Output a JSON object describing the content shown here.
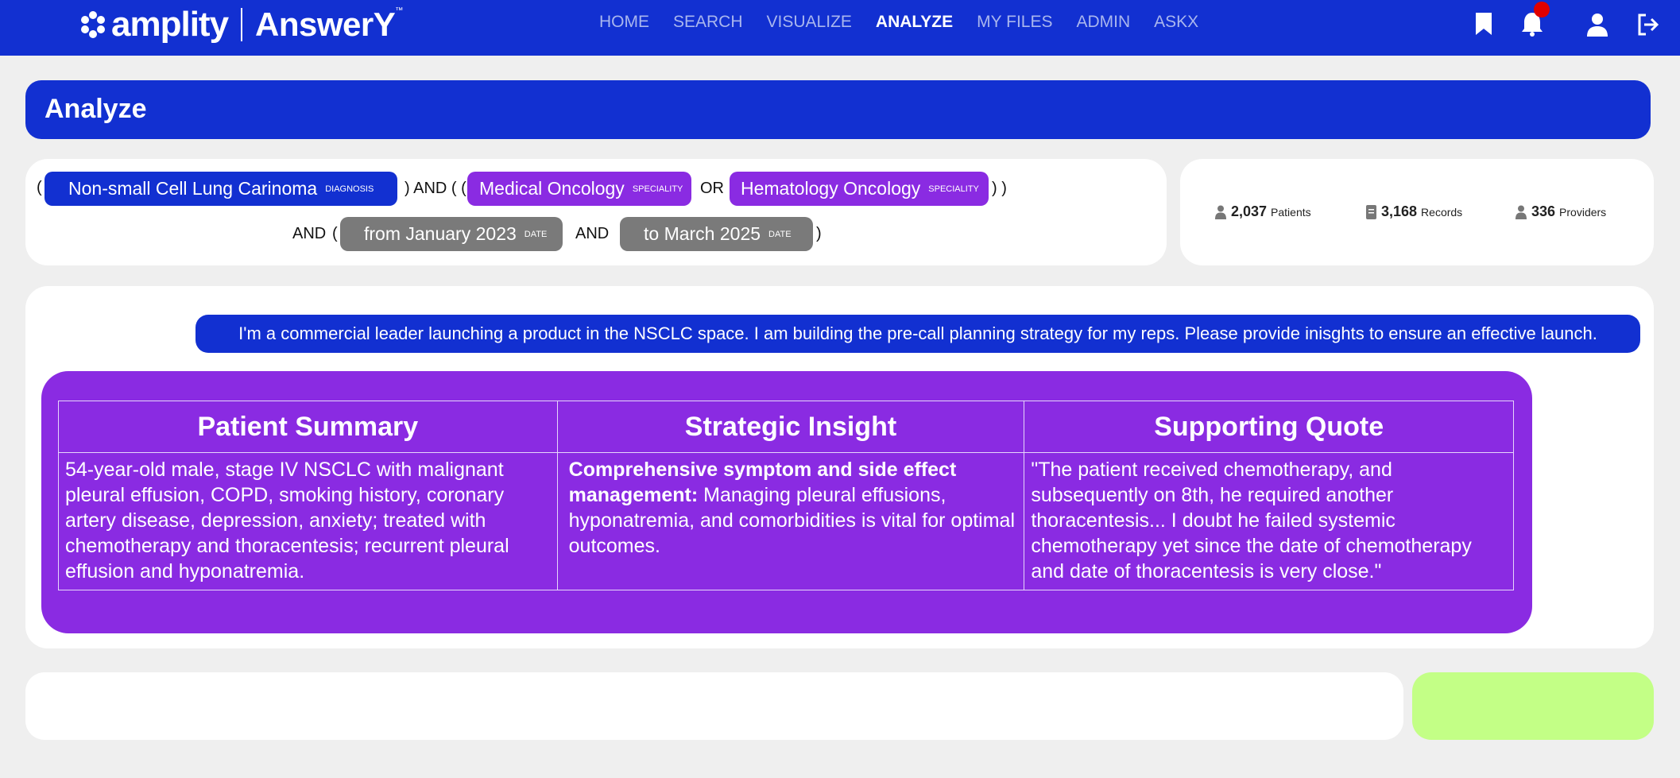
{
  "header": {
    "brand": "amplity",
    "product": "AnswerY",
    "trademark": "™",
    "nav": [
      {
        "label": "HOME",
        "active": false
      },
      {
        "label": "SEARCH",
        "active": false
      },
      {
        "label": "VISUALIZE",
        "active": false
      },
      {
        "label": "ANALYZE",
        "active": true
      },
      {
        "label": "MY FILES",
        "active": false
      },
      {
        "label": "ADMIN",
        "active": false
      },
      {
        "label": "ASKX",
        "active": false
      }
    ],
    "icons": [
      "bookmark-icon",
      "bell-icon",
      "user-icon",
      "logout-icon"
    ],
    "notification_color": "#e00000"
  },
  "page": {
    "title": "Analyze"
  },
  "query": {
    "open_paren": "(",
    "diagnosis": {
      "label": "Non-small Cell Lung Carinoma",
      "tag": "DIAGNOSIS"
    },
    "and_open": ") AND ( (",
    "specialty1": {
      "label": "Medical Oncology",
      "tag": "SPECIALITY"
    },
    "or": "OR",
    "specialty2": {
      "label": "Hematology Oncology",
      "tag": "SPECIALITY"
    },
    "close": ") )",
    "and2": "AND",
    "open2": "(",
    "date_from": {
      "label": "from January 2023",
      "tag": "DATE"
    },
    "and3": "AND",
    "date_to": {
      "label": "to March 2025",
      "tag": "DATE"
    },
    "close2": ")"
  },
  "stats": {
    "patients": {
      "value": "2,037",
      "label": "Patients"
    },
    "records": {
      "value": "3,168",
      "label": "Records"
    },
    "providers": {
      "value": "336",
      "label": "Providers"
    }
  },
  "chat": {
    "user_message": "I'm a commercial leader launching a product in the NSCLC space. I am building the pre-call planning strategy for my reps. Please provide inisghts to ensure an effective launch.",
    "table": {
      "headers": [
        "Patient Summary",
        "Strategic Insight",
        "Supporting Quote"
      ],
      "row": {
        "summary": "54-year-old male, stage IV NSCLC with malignant pleural effusion, COPD, smoking history, coronary artery disease, depression, anxiety; treated with chemotherapy and thoracentesis; recurrent pleural effusion and hyponatremia.",
        "insight_bold": "Comprehensive symptom and side effect management:",
        "insight_text": " Managing pleural effusions, hyponatremia, and comorbidities is vital for optimal outcomes.",
        "quote": "\"The patient received chemotherapy, and subsequently on 8th, he required another thoracentesis... I doubt he failed systemic chemotherapy yet since the date of chemotherapy and date of thoracentesis is very close.\""
      }
    }
  },
  "colors": {
    "primary": "#1230d1",
    "purple": "#8a2be2",
    "gray_pill": "#7a7a7a",
    "send_button": "#c3ff86",
    "background": "#efefef"
  }
}
